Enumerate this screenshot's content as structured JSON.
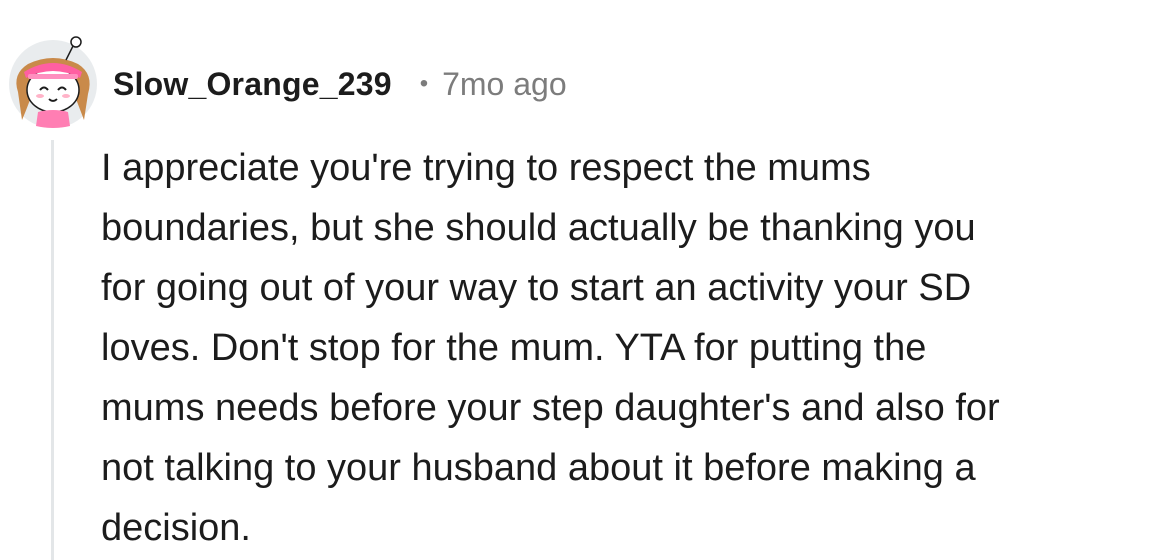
{
  "comment": {
    "author": "Slow_Orange_239",
    "separator": "•",
    "timestamp": "7mo ago",
    "body_lines": [
      "I appreciate you're trying to respect the mums",
      "boundaries, but she should actually be thanking you",
      "for going out of your way to start an activity your SD",
      "loves. Don't stop for the mum. YTA for putting the",
      "mums needs before your step daughter's and also for",
      "not talking to your husband about it before making a",
      "decision."
    ]
  },
  "colors": {
    "text": "#1c1c1c",
    "meta": "#7c7c7c",
    "thread_line": "#e3e6e8",
    "avatar_bg": "#e9ecee",
    "avatar_accent": "#ff5fa2"
  },
  "icons": {
    "avatar": "snoo-avatar-pink-visor"
  }
}
